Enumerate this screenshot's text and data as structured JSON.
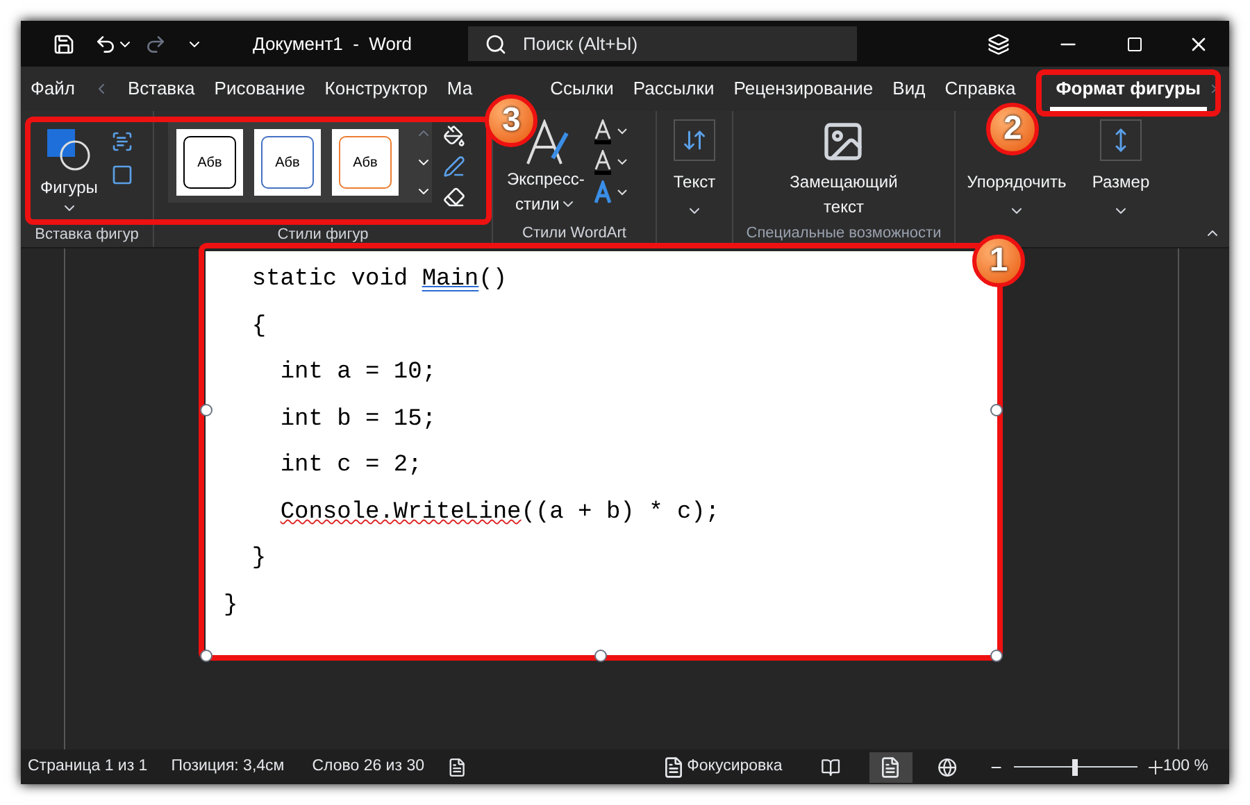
{
  "window": {
    "title": "Документ1  -  Word",
    "search": {
      "placeholder": "Поиск (Alt+Ы)"
    }
  },
  "tabs": [
    {
      "label": "Файл",
      "selected": false
    },
    {
      "label": "Вставка",
      "selected": false
    },
    {
      "label": "Рисование",
      "selected": false
    },
    {
      "label": "Конструктор",
      "selected": false
    },
    {
      "label": "Ма",
      "selected": false
    },
    {
      "label": "Ссылки",
      "selected": false
    },
    {
      "label": "Рассылки",
      "selected": false
    },
    {
      "label": "Рецензирование",
      "selected": false
    },
    {
      "label": "Вид",
      "selected": false
    },
    {
      "label": "Справка",
      "selected": false
    },
    {
      "label": "Формат фигуры",
      "selected": true
    }
  ],
  "ribbon": {
    "shapes_button": "Фигуры",
    "style_thumbnails": [
      {
        "label": "Абв",
        "color": "#000000"
      },
      {
        "label": "Абв",
        "color": "#4472c4"
      },
      {
        "label": "Абв",
        "color": "#ed7d31"
      }
    ],
    "express_styles": [
      "Экспресс-",
      "стили"
    ],
    "text_button": "Текст",
    "alt_text_button": [
      "Замещающий",
      "текст"
    ],
    "arrange_button": "Упорядочить",
    "size_button": "Размер",
    "groups": [
      "Вставка фигур",
      "Стили фигур",
      "Стили WordArt",
      "Специальные возможности"
    ]
  },
  "code_lines": [
    {
      "segments": [
        {
          "text": "  static void "
        },
        {
          "text": "Main",
          "kind": "grammar"
        },
        {
          "text": "()"
        }
      ]
    },
    {
      "segments": [
        {
          "text": "  {"
        }
      ]
    },
    {
      "segments": [
        {
          "text": "    int a = 10;"
        }
      ]
    },
    {
      "segments": [
        {
          "text": "    int b = 15;"
        }
      ]
    },
    {
      "segments": [
        {
          "text": "    int c = 2;"
        }
      ]
    },
    {
      "segments": [
        {
          "text": "    Console.WriteLine",
          "kind": "spelling"
        },
        {
          "text": "((a + b) * c);"
        }
      ]
    },
    {
      "segments": [
        {
          "text": "  }"
        }
      ]
    },
    {
      "segments": [
        {
          "text": "}"
        }
      ]
    }
  ],
  "status_bar": {
    "page": "Страница 1 из 1",
    "position": "Позиция: 3,4см",
    "words": "Слово 26 из 30",
    "focus": "Фокусировка",
    "zoom_slider": {
      "level": 0.5
    },
    "zoom": "100 %"
  },
  "callouts": [
    "1",
    "2",
    "3"
  ]
}
